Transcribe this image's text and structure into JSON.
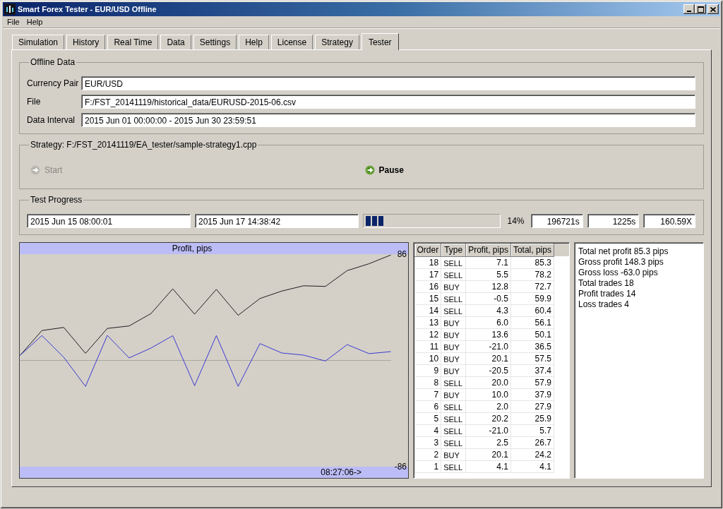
{
  "window": {
    "title": "Smart Forex Tester - EUR/USD Offline"
  },
  "menu": [
    "File",
    "Help"
  ],
  "tabs": [
    {
      "label": "Simulation",
      "selected": false
    },
    {
      "label": "History",
      "selected": false
    },
    {
      "label": "Real Time",
      "selected": false
    },
    {
      "label": "Data",
      "selected": false
    },
    {
      "label": "Settings",
      "selected": false
    },
    {
      "label": "Help",
      "selected": false
    },
    {
      "label": "License",
      "selected": false
    },
    {
      "label": "Strategy",
      "selected": false
    },
    {
      "label": "Tester",
      "selected": true
    }
  ],
  "offline_data": {
    "title": "Offline Data",
    "fields": [
      {
        "label": "Currency Pair",
        "value": "EUR/USD"
      },
      {
        "label": "File",
        "value": "F:/FST_20141119/historical_data/EURUSD-2015-06.csv"
      },
      {
        "label": "Data Interval",
        "value": "2015 Jun 01 00:00:00 - 2015 Jun 30 23:59:51"
      }
    ]
  },
  "strategy": {
    "title": "Strategy: F:/FST_20141119/EA_tester/sample-strategy1.cpp",
    "buttons": [
      {
        "label": "Start",
        "disabled": true
      },
      {
        "label": "Pause",
        "disabled": false
      }
    ]
  },
  "test_progress": {
    "title": "Test Progress",
    "start_time": "2015 Jun 15 08:00:01",
    "current_time": "2015 Jun 17 14:38:42",
    "progress": {
      "level": 0.14,
      "reading": "14%"
    },
    "counters": [
      "196721s",
      "1225s",
      "160.59X"
    ]
  },
  "chart": {
    "chart_data": [
      {
        "type": "line",
        "title": "Profit, pips",
        "ylim": [
          -86,
          86
        ],
        "yticks": [
          86,
          -86
        ],
        "series": [
          {
            "color": "#1e1e1e",
            "values": [
              4.1,
              24.2,
              26.7,
              5.7,
              25.9,
              27.9,
              37.9,
              57.9,
              37.4,
              57.5,
              36.5,
              50.1,
              56.1,
              60.4,
              59.9,
              72.7,
              78.2,
              85.3
            ]
          },
          {
            "color": "#3a3ad0",
            "values": [
              4.1,
              20.1,
              2.5,
              -21.0,
              20.2,
              2.0,
              10.0,
              20.0,
              -20.5,
              20.1,
              -21.0,
              13.6,
              6.0,
              4.3,
              -0.5,
              12.8,
              5.5,
              7.1
            ]
          }
        ],
        "ref_lines": [
          {
            "axis": "y",
            "value": 0,
            "color": "#a8a6a0"
          }
        ],
        "annotations": [
          "08:27:06->"
        ]
      }
    ]
  },
  "orders": {
    "columns": [
      "Order",
      "Type",
      "Profit, pips",
      "Total, pips"
    ],
    "rows": [
      [
        "18",
        "SELL",
        "7.1",
        "85.3"
      ],
      [
        "17",
        "SELL",
        "5.5",
        "78.2"
      ],
      [
        "16",
        "BUY",
        "12.8",
        "72.7"
      ],
      [
        "15",
        "SELL",
        "-0.5",
        "59.9"
      ],
      [
        "14",
        "SELL",
        "4.3",
        "60.4"
      ],
      [
        "13",
        "BUY",
        "6.0",
        "56.1"
      ],
      [
        "12",
        "BUY",
        "13.6",
        "50.1"
      ],
      [
        "11",
        "BUY",
        "-21.0",
        "36.5"
      ],
      [
        "10",
        "BUY",
        "20.1",
        "57.5"
      ],
      [
        "9",
        "BUY",
        "-20.5",
        "37.4"
      ],
      [
        "8",
        "SELL",
        "20.0",
        "57.9"
      ],
      [
        "7",
        "BUY",
        "10.0",
        "37.9"
      ],
      [
        "6",
        "SELL",
        "2.0",
        "27.9"
      ],
      [
        "5",
        "SELL",
        "20.2",
        "25.9"
      ],
      [
        "4",
        "SELL",
        "-21.0",
        "5.7"
      ],
      [
        "3",
        "SELL",
        "2.5",
        "26.7"
      ],
      [
        "2",
        "BUY",
        "20.1",
        "24.2"
      ],
      [
        "1",
        "SELL",
        "4.1",
        "4.1"
      ]
    ]
  },
  "summary": [
    "Total net profit 85.3 pips",
    "Gross profit 148.3 pips",
    "Gross loss -63.0 pips",
    "Total trades 18",
    "Profit trades 14",
    "Loss trades 4"
  ]
}
